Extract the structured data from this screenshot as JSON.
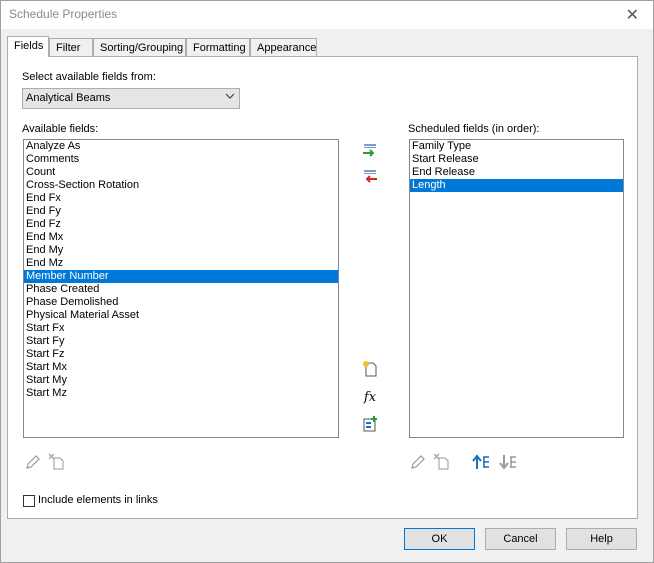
{
  "window": {
    "title": "Schedule Properties"
  },
  "tabs": [
    {
      "label": "Fields",
      "active": true
    },
    {
      "label": "Filter",
      "active": false
    },
    {
      "label": "Sorting/Grouping",
      "active": false
    },
    {
      "label": "Formatting",
      "active": false
    },
    {
      "label": "Appearance",
      "active": false
    }
  ],
  "select_from": {
    "label": "Select available fields from:",
    "value": "Analytical Beams"
  },
  "available": {
    "label": "Available fields:",
    "items": [
      "Analyze As",
      "Comments",
      "Count",
      "Cross-Section Rotation",
      "End Fx",
      "End Fy",
      "End Fz",
      "End Mx",
      "End My",
      "End Mz",
      "Member Number",
      "Phase Created",
      "Phase Demolished",
      "Physical Material Asset",
      "Start Fx",
      "Start Fy",
      "Start Fz",
      "Start Mx",
      "Start My",
      "Start Mz"
    ],
    "selected": "Member Number"
  },
  "scheduled": {
    "label": "Scheduled fields (in order):",
    "items": [
      "Family Type",
      "Start Release",
      "End Release",
      "Length"
    ],
    "selected": "Length"
  },
  "include_links": {
    "label": "Include elements in links",
    "checked": false
  },
  "buttons": {
    "ok": "OK",
    "cancel": "Cancel",
    "help": "Help"
  },
  "icons": {
    "add_parameter": "add-parameter-icon",
    "remove_parameter": "remove-parameter-icon",
    "new_parameter": "new-parameter-icon",
    "calculated_value": "fx-icon",
    "combine_parameters": "combine-parameters-icon",
    "edit": "pencil-icon",
    "delete": "delete-icon",
    "move_up": "move-up-icon",
    "move_down": "move-down-icon"
  },
  "colors": {
    "selection": "#0078d7",
    "add_arrow": "#2e9e3a",
    "remove_arrow": "#d6261f",
    "move_arrow": "#1e6fc2"
  }
}
